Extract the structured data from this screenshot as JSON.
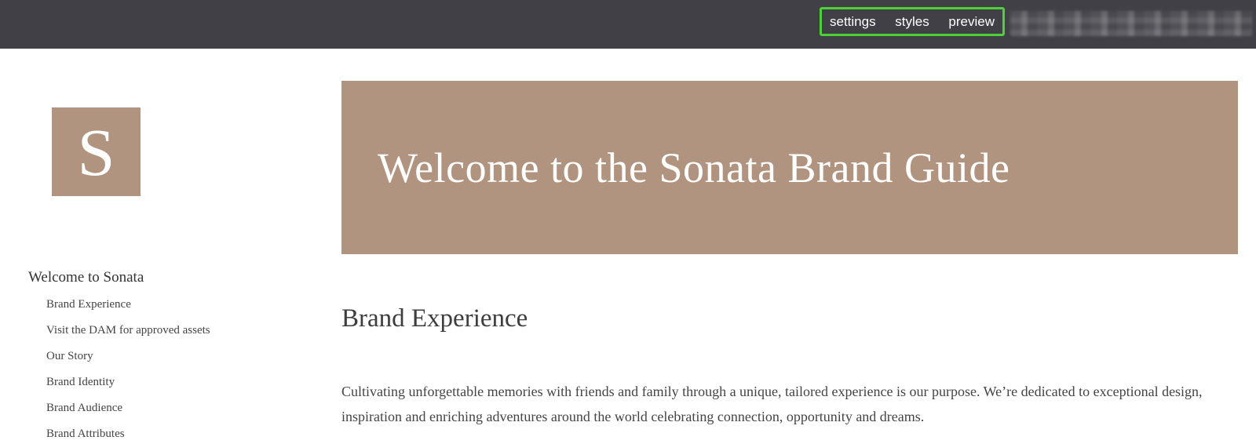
{
  "topbar": {
    "nav": {
      "settings": "settings",
      "styles": "styles",
      "preview": "preview"
    }
  },
  "logo": {
    "letter": "S"
  },
  "sidebar": {
    "section_title": "Welcome to Sonata",
    "items": [
      {
        "label": "Brand Experience"
      },
      {
        "label": "Visit the DAM for approved assets"
      },
      {
        "label": "Our Story"
      },
      {
        "label": "Brand Identity"
      },
      {
        "label": "Brand Audience"
      },
      {
        "label": "Brand Attributes"
      }
    ]
  },
  "hero": {
    "title": "Welcome to the Sonata Brand Guide"
  },
  "content": {
    "heading": "Brand Experience",
    "paragraph": "Cultivating unforgettable memories with friends and family through a unique, tailored experience is our purpose. We’re dedicated to exceptional design, inspiration and enriching adventures around the world celebrating connection, opportunity and dreams."
  },
  "colors": {
    "topbar_bg": "#414047",
    "accent_brown": "#b1947f",
    "highlight_green": "#4cd137"
  }
}
